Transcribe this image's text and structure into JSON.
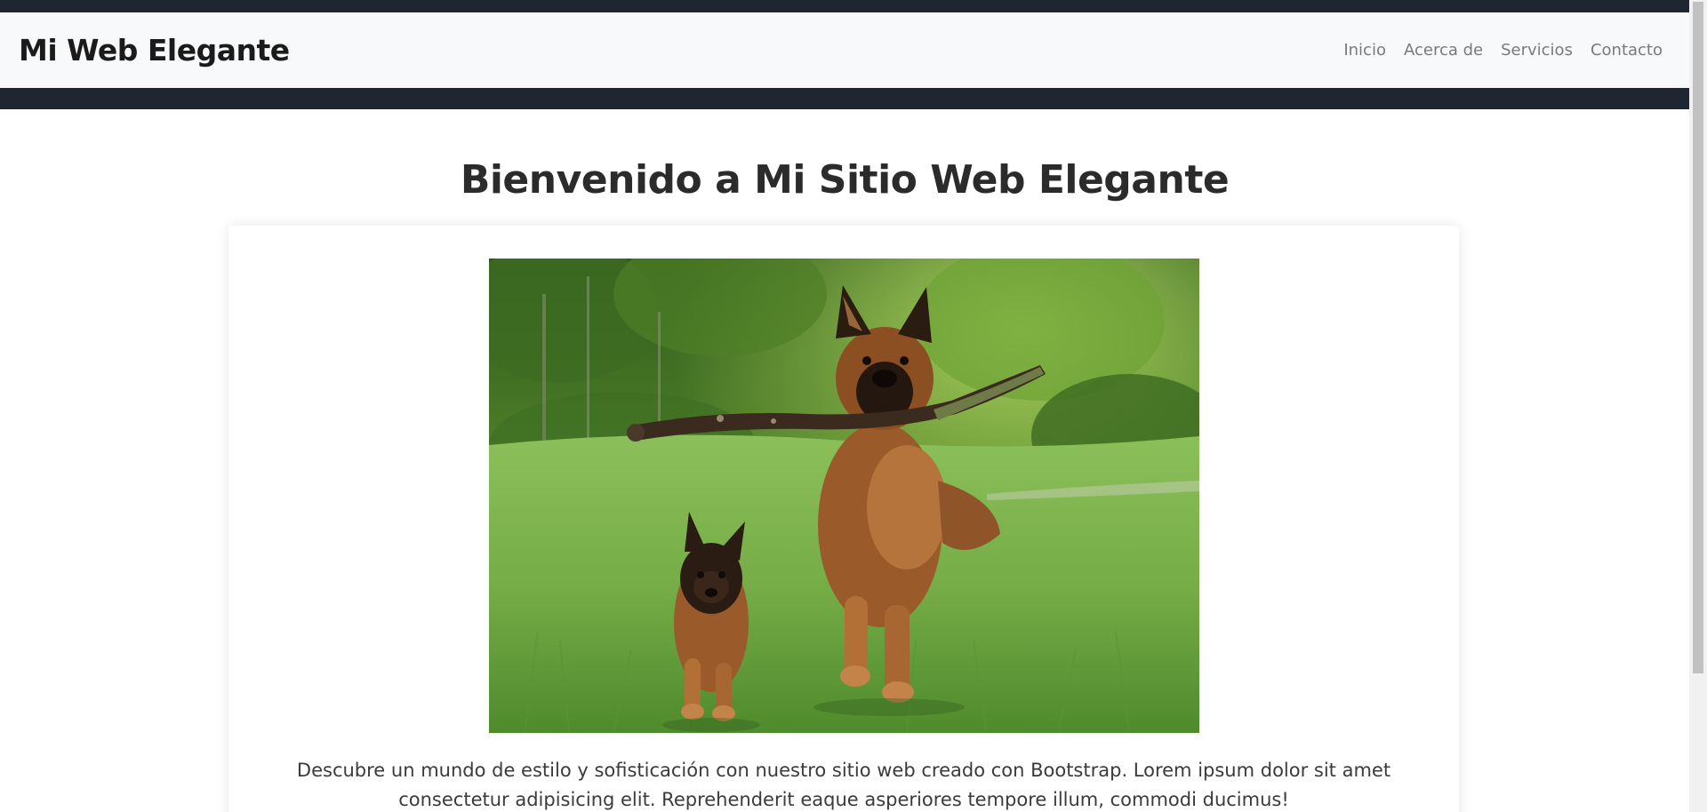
{
  "navbar": {
    "brand": "Mi Web Elegante",
    "links": [
      {
        "label": "Inicio"
      },
      {
        "label": "Acerca de"
      },
      {
        "label": "Servicios"
      },
      {
        "label": "Contacto"
      }
    ]
  },
  "main": {
    "title": "Bienvenido a Mi Sitio Web Elegante",
    "card": {
      "image_alt": "German shepherd and puppy running on grass with a stick",
      "text": "Descubre un mundo de estilo y sofisticación con nuestro sitio web creado con Bootstrap. Lorem ipsum dolor sit amet consectetur adipisicing elit. Reprehenderit eaque asperiores tempore illum, commodi ducimus!"
    }
  },
  "colors": {
    "dark_strip": "#1f2631",
    "navbar_bg": "#f8f9fa",
    "title_text": "#2b2b2b",
    "nav_link": "#7a7a7a"
  }
}
